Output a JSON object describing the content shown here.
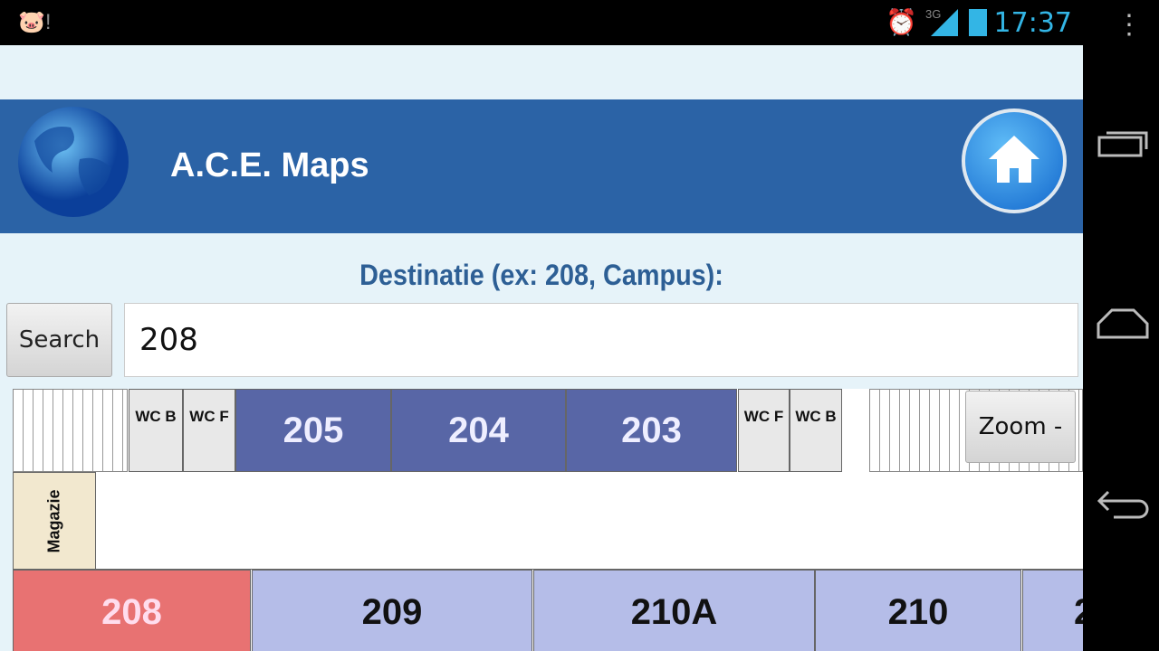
{
  "status_bar": {
    "time": "17:37",
    "network": "3G",
    "icons": [
      "notification-icon",
      "alarm-icon",
      "signal-icon",
      "battery-icon"
    ]
  },
  "header": {
    "title": "A.C.E. Maps",
    "logo": "globe-icon",
    "home": "home-icon"
  },
  "search": {
    "label": "Destinatie (ex: 208, Campus):",
    "button": "Search",
    "value": "208"
  },
  "map": {
    "zoom_button": "Zoom -",
    "top_rooms": [
      "WC B",
      "WC F",
      "205",
      "204",
      "203",
      "WC F",
      "WC B"
    ],
    "storage": "Magazie",
    "bottom_rooms": [
      "208",
      "209",
      "210A",
      "210",
      "2"
    ],
    "highlight_color": "#e87272",
    "room_color": "#b5bde8",
    "dark_room_color": "#5866a6"
  }
}
